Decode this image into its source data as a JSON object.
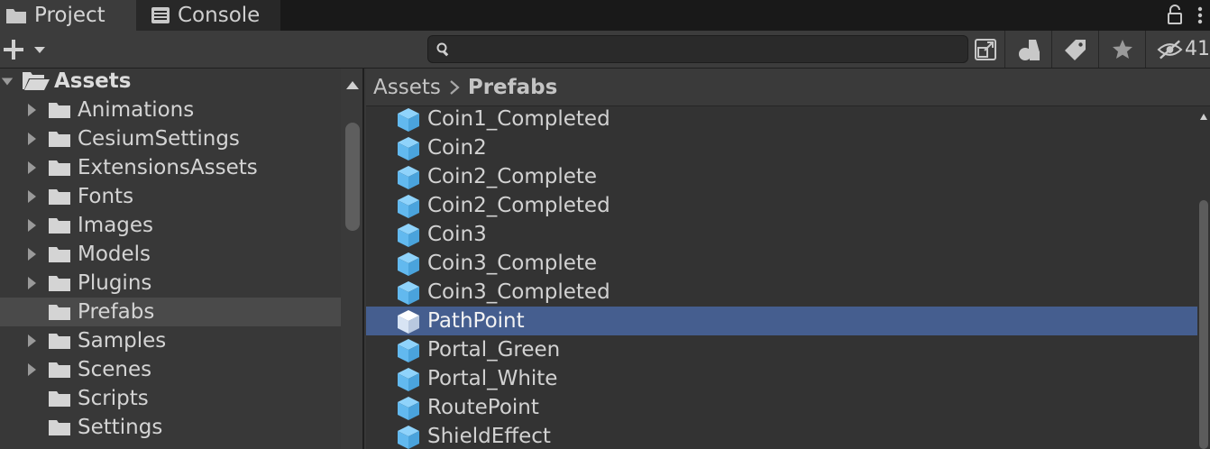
{
  "tabs": {
    "project_label": "Project",
    "console_label": "Console"
  },
  "toolbar": {
    "search_placeholder": "",
    "hidden_count": "41"
  },
  "tree": {
    "root_label": "Assets",
    "items": [
      {
        "label": "Animations",
        "has_arrow": true
      },
      {
        "label": "CesiumSettings",
        "has_arrow": true
      },
      {
        "label": "ExtensionsAssets",
        "has_arrow": true
      },
      {
        "label": "Fonts",
        "has_arrow": true
      },
      {
        "label": "Images",
        "has_arrow": true
      },
      {
        "label": "Models",
        "has_arrow": true
      },
      {
        "label": "Plugins",
        "has_arrow": true
      },
      {
        "label": "Prefabs",
        "has_arrow": false,
        "selected": true
      },
      {
        "label": "Samples",
        "has_arrow": true
      },
      {
        "label": "Scenes",
        "has_arrow": true
      },
      {
        "label": "Scripts",
        "has_arrow": false
      },
      {
        "label": "Settings",
        "has_arrow": false
      }
    ]
  },
  "breadcrumb": {
    "root": "Assets",
    "current": "Prefabs"
  },
  "files": [
    {
      "label": "Coin1_Completed"
    },
    {
      "label": "Coin2"
    },
    {
      "label": "Coin2_Complete"
    },
    {
      "label": "Coin2_Completed"
    },
    {
      "label": "Coin3"
    },
    {
      "label": "Coin3_Complete"
    },
    {
      "label": "Coin3_Completed"
    },
    {
      "label": "PathPoint",
      "selected": true
    },
    {
      "label": "Portal_Green"
    },
    {
      "label": "Portal_White"
    },
    {
      "label": "RoutePoint"
    },
    {
      "label": "ShieldEffect"
    }
  ],
  "colors": {
    "selection_blue": "#455e8f",
    "prefab_icon": "#7fc8f5"
  },
  "icons": {
    "folder": "folder-icon",
    "prefab": "prefab-cube-icon"
  }
}
